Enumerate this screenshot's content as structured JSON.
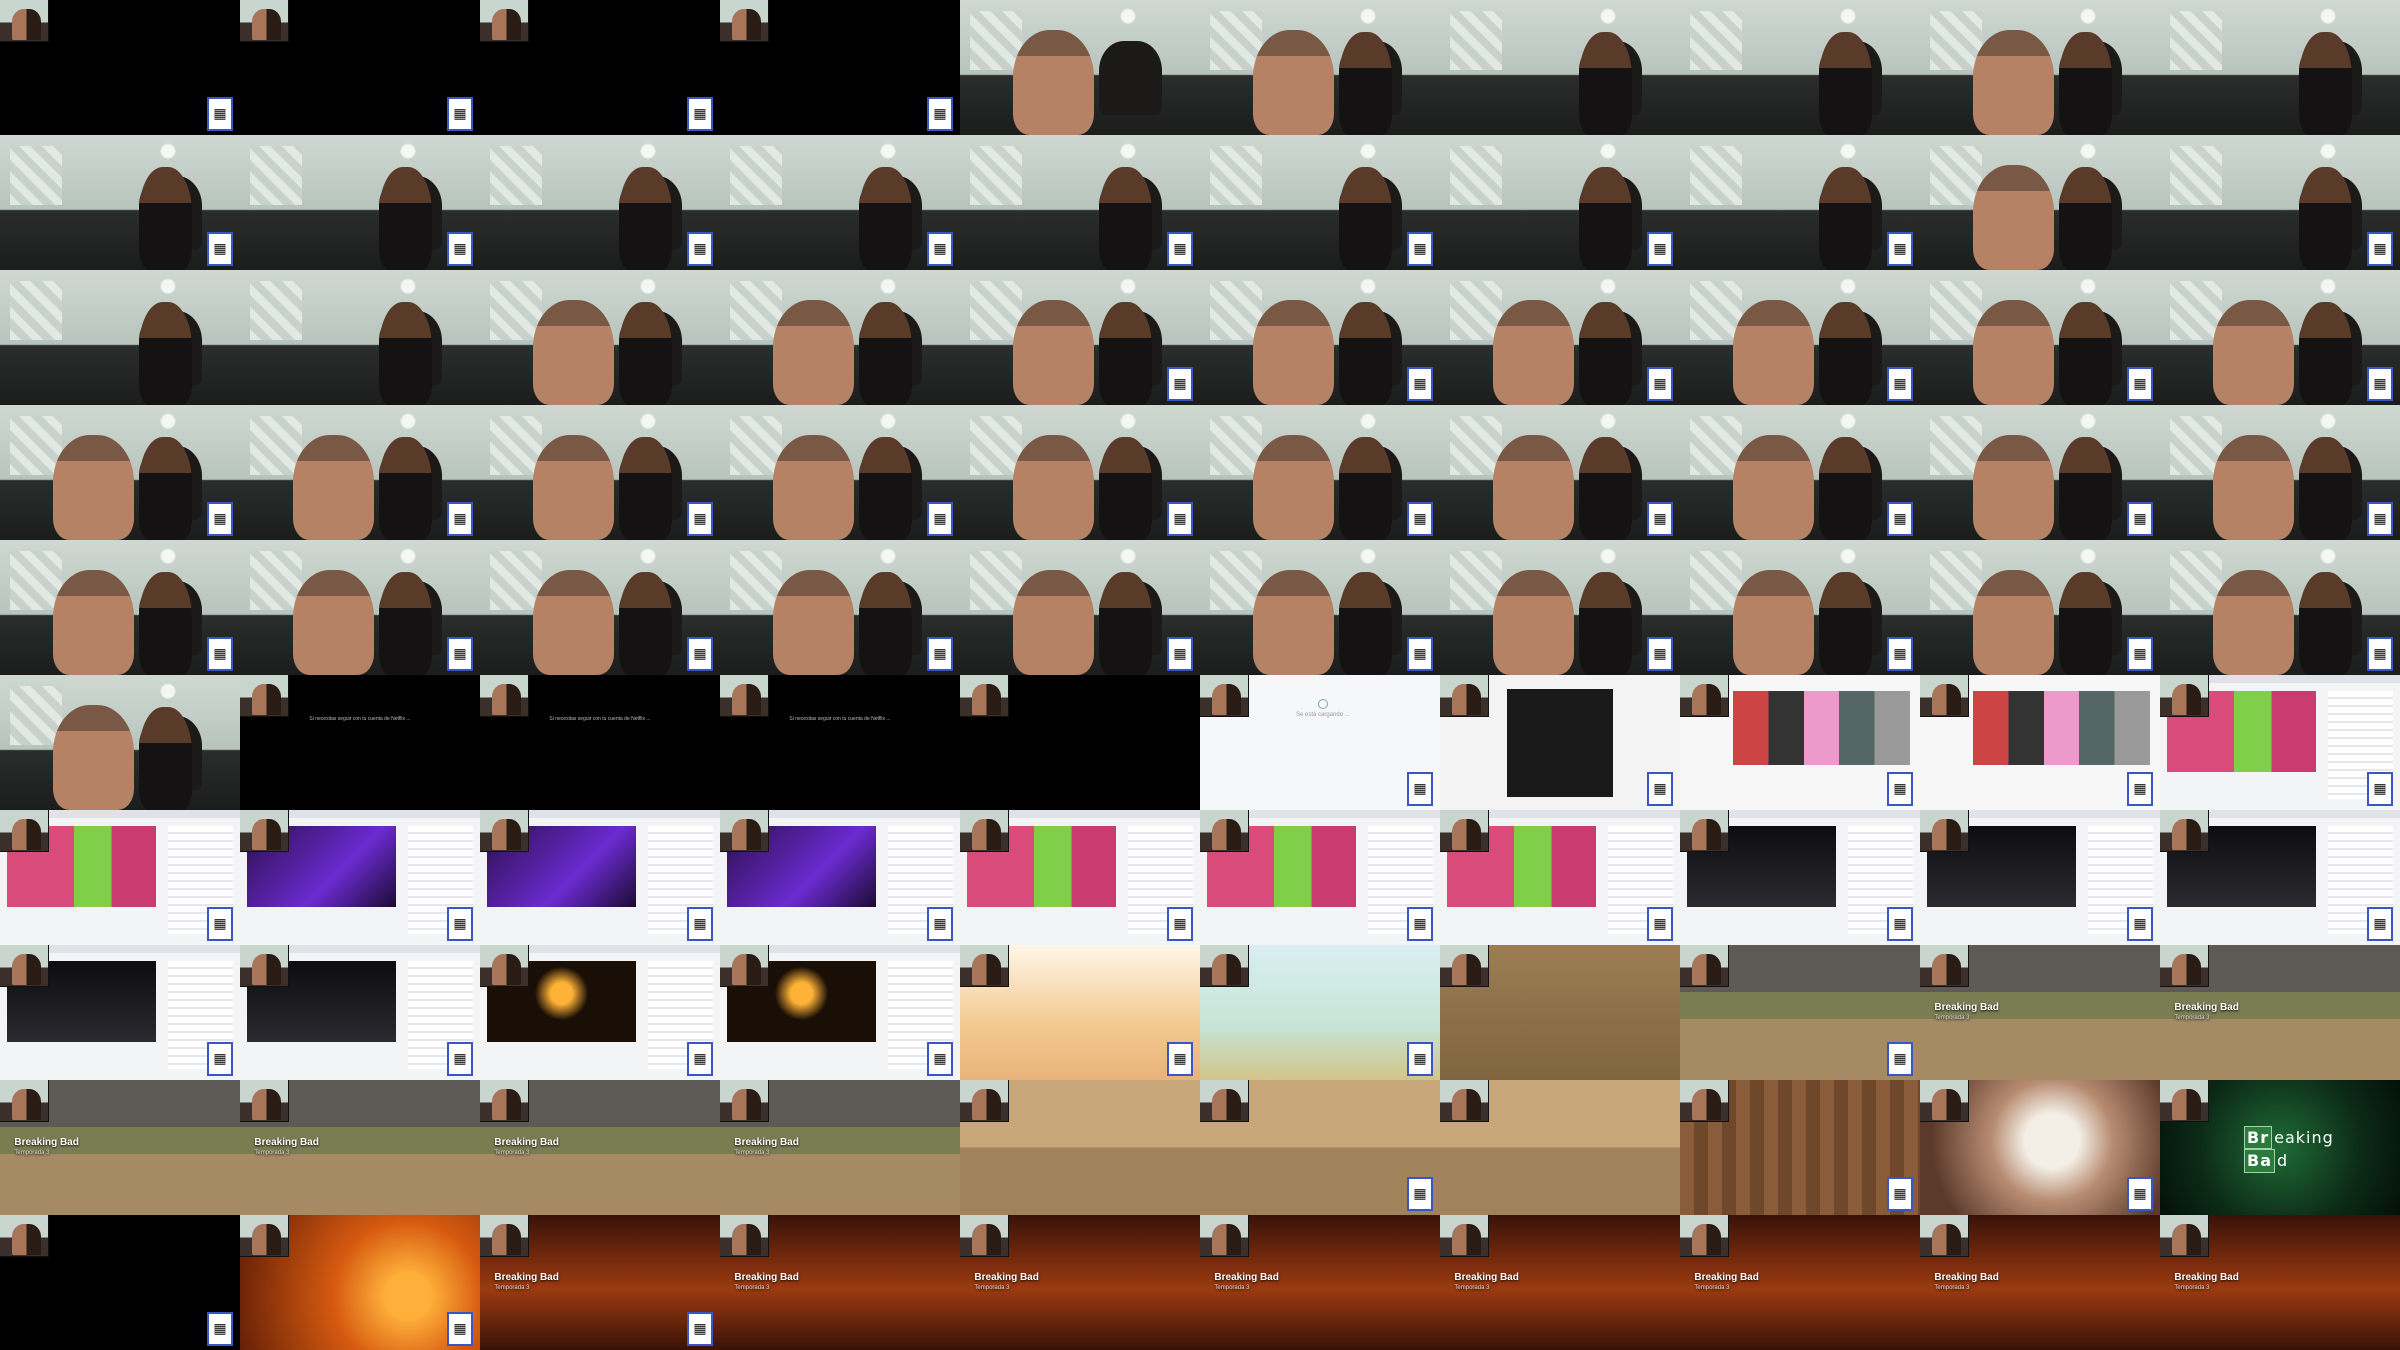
{
  "window": {
    "title": "",
    "grid_columns": 10,
    "grid_rows": 10
  },
  "icons": {
    "qr": "qr-code-icon",
    "spinner": "loading-spinner-icon"
  },
  "texts": {
    "breaking_bad_title": "Breaking Bad",
    "breaking_bad_subtitle": "Temporada 3",
    "breaking_bad_episode": "Breaking Bad",
    "breaking_bad_logo_line1_sym": "Br",
    "breaking_bad_logo_line1_rest": "eaking",
    "breaking_bad_logo_line2_sym": "Ba",
    "breaking_bad_logo_line2_rest": "d",
    "loading": "Se está cargando ...",
    "caption": "Si necesitas seguir con tu cuenta de Netflix ..."
  },
  "tiles": [
    {
      "scene": "black",
      "cam": true,
      "qr": true
    },
    {
      "scene": "black",
      "cam": true,
      "qr": true
    },
    {
      "scene": "black",
      "cam": true,
      "qr": true
    },
    {
      "scene": "black",
      "cam": true,
      "qr": true
    },
    {
      "scene": "room",
      "man": true,
      "woman": false
    },
    {
      "scene": "room",
      "man": true,
      "woman": true
    },
    {
      "scene": "room",
      "man": false,
      "woman": true
    },
    {
      "scene": "room",
      "man": false,
      "woman": true
    },
    {
      "scene": "room",
      "man": true,
      "woman": true
    },
    {
      "scene": "room",
      "man": false,
      "woman": true
    },
    {
      "scene": "room",
      "woman": true,
      "qr": true
    },
    {
      "scene": "room",
      "woman": true,
      "qr": true
    },
    {
      "scene": "room",
      "woman": true,
      "qr": true
    },
    {
      "scene": "room",
      "woman": true,
      "qr": true
    },
    {
      "scene": "room",
      "woman": true,
      "qr": true
    },
    {
      "scene": "room",
      "woman": true,
      "qr": true
    },
    {
      "scene": "room",
      "woman": true,
      "qr": true
    },
    {
      "scene": "room",
      "woman": true,
      "qr": true
    },
    {
      "scene": "room",
      "man": true,
      "woman": true
    },
    {
      "scene": "room",
      "woman": true,
      "qr": true
    },
    {
      "scene": "room",
      "woman": true
    },
    {
      "scene": "room",
      "woman": true
    },
    {
      "scene": "room",
      "man": true,
      "woman": true
    },
    {
      "scene": "room",
      "man": true,
      "woman": true
    },
    {
      "scene": "room",
      "man": true,
      "woman": true,
      "qr": true
    },
    {
      "scene": "room",
      "man": true,
      "woman": true,
      "qr": true
    },
    {
      "scene": "room",
      "man": true,
      "woman": true,
      "qr": true
    },
    {
      "scene": "room",
      "man": true,
      "woman": true,
      "qr": true
    },
    {
      "scene": "room",
      "man": true,
      "woman": true,
      "qr": true
    },
    {
      "scene": "room",
      "man": true,
      "woman": true,
      "qr": true
    },
    {
      "scene": "room",
      "man": true,
      "woman": true,
      "qr": true
    },
    {
      "scene": "room",
      "man": true,
      "woman": true,
      "qr": true
    },
    {
      "scene": "room",
      "man": true,
      "woman": true,
      "qr": true
    },
    {
      "scene": "room",
      "man": true,
      "woman": true,
      "qr": true
    },
    {
      "scene": "room",
      "man": true,
      "woman": true,
      "qr": true
    },
    {
      "scene": "room",
      "man": true,
      "woman": true,
      "qr": true
    },
    {
      "scene": "room",
      "man": true,
      "woman": true,
      "qr": true
    },
    {
      "scene": "room",
      "man": true,
      "woman": true,
      "qr": true
    },
    {
      "scene": "room",
      "man": true,
      "woman": true,
      "qr": true
    },
    {
      "scene": "room",
      "man": true,
      "woman": true,
      "qr": true
    },
    {
      "scene": "room",
      "man": true,
      "woman": true,
      "qr": true
    },
    {
      "scene": "room",
      "man": true,
      "woman": true,
      "qr": true
    },
    {
      "scene": "room",
      "man": true,
      "woman": true,
      "qr": true
    },
    {
      "scene": "room",
      "man": true,
      "woman": true,
      "qr": true
    },
    {
      "scene": "room",
      "man": true,
      "woman": true,
      "qr": true
    },
    {
      "scene": "room",
      "man": true,
      "woman": true,
      "qr": true
    },
    {
      "scene": "room",
      "man": true,
      "woman": true,
      "qr": true
    },
    {
      "scene": "room",
      "man": true,
      "woman": true,
      "qr": true
    },
    {
      "scene": "room",
      "man": true,
      "woman": true,
      "qr": true
    },
    {
      "scene": "room",
      "man": true,
      "woman": true,
      "qr": true
    },
    {
      "scene": "room",
      "man": true,
      "woman": true
    },
    {
      "scene": "lost",
      "cam": true,
      "caption": true
    },
    {
      "scene": "lost",
      "cam": true,
      "caption": true
    },
    {
      "scene": "lost",
      "cam": true,
      "caption": true
    },
    {
      "scene": "black",
      "cam": true
    },
    {
      "scene": "white",
      "cam": true,
      "loading": true,
      "qr": true
    },
    {
      "scene": "fb",
      "cam": true,
      "qr": true
    },
    {
      "scene": "store",
      "cam": true,
      "qr": true
    },
    {
      "scene": "store",
      "cam": true,
      "qr": true
    },
    {
      "scene": "browser",
      "variant": "pinkgreen",
      "cam": true,
      "qr": true
    },
    {
      "scene": "browser",
      "variant": "pinkgreen",
      "cam": true,
      "qr": true
    },
    {
      "scene": "browser",
      "variant": "purple",
      "cam": true,
      "qr": true
    },
    {
      "scene": "browser",
      "variant": "purple",
      "cam": true,
      "qr": true
    },
    {
      "scene": "browser",
      "variant": "purple",
      "cam": true,
      "qr": true
    },
    {
      "scene": "browser",
      "variant": "pinkgreen",
      "cam": true,
      "qr": true
    },
    {
      "scene": "browser",
      "variant": "pinkgreen",
      "cam": true,
      "qr": true
    },
    {
      "scene": "browser",
      "variant": "pinkgreen",
      "cam": true,
      "qr": true
    },
    {
      "scene": "browser",
      "variant": "dark",
      "cam": true,
      "qr": true
    },
    {
      "scene": "browser",
      "variant": "dark",
      "cam": true,
      "qr": true
    },
    {
      "scene": "browser",
      "variant": "dark",
      "cam": true,
      "qr": true
    },
    {
      "scene": "browser",
      "variant": "dark",
      "cam": true,
      "qr": true
    },
    {
      "scene": "browser",
      "variant": "dark",
      "cam": true,
      "qr": true
    },
    {
      "scene": "browser",
      "variant": "fire",
      "cam": true,
      "qr": true
    },
    {
      "scene": "browser",
      "variant": "fire",
      "cam": true,
      "qr": true
    },
    {
      "scene": "glare",
      "cam": true,
      "qr": true
    },
    {
      "scene": "sky",
      "cam": true,
      "qr": true
    },
    {
      "scene": "sand",
      "cam": true
    },
    {
      "scene": "river",
      "cam": true,
      "qr": true
    },
    {
      "scene": "river",
      "cam": true,
      "title": true
    },
    {
      "scene": "river",
      "cam": true,
      "title": true
    },
    {
      "scene": "river",
      "cam": true,
      "title": true
    },
    {
      "scene": "river",
      "cam": true,
      "title": true
    },
    {
      "scene": "river",
      "cam": true,
      "title": true
    },
    {
      "scene": "river",
      "cam": true,
      "title": true
    },
    {
      "scene": "river2",
      "cam": true
    },
    {
      "scene": "river2",
      "cam": true,
      "qr": true
    },
    {
      "scene": "river2",
      "cam": true
    },
    {
      "scene": "plaid",
      "cam": true,
      "qr": true
    },
    {
      "scene": "glass",
      "cam": true,
      "qr": true
    },
    {
      "scene": "green",
      "cam": true,
      "logo": true
    },
    {
      "scene": "black",
      "cam": true,
      "qr": true
    },
    {
      "scene": "orangeBright",
      "cam": true,
      "qr": true
    },
    {
      "scene": "orange",
      "cam": true,
      "title": true,
      "qr": true
    },
    {
      "scene": "orange",
      "cam": true,
      "title": true
    },
    {
      "scene": "orange",
      "cam": true,
      "title": true
    },
    {
      "scene": "orange",
      "cam": true,
      "title": true
    },
    {
      "scene": "orange",
      "cam": true,
      "title": true
    },
    {
      "scene": "orange",
      "cam": true,
      "title": true
    },
    {
      "scene": "orange",
      "cam": true,
      "title": true
    },
    {
      "scene": "orange",
      "cam": true,
      "title": true
    }
  ]
}
